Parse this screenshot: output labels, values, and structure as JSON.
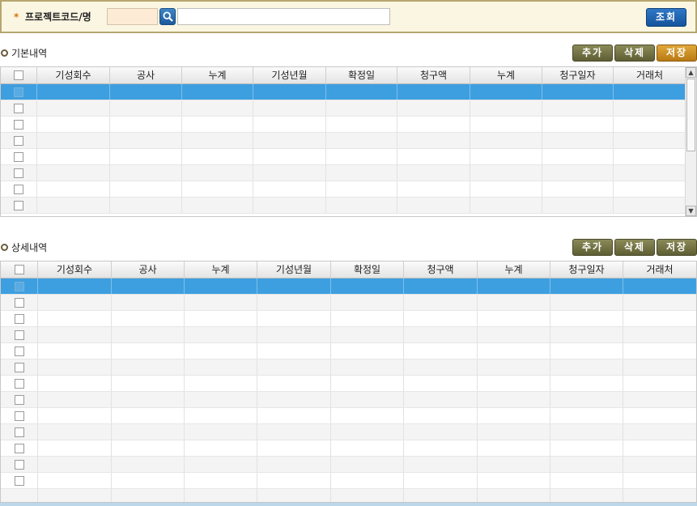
{
  "search": {
    "required_mark": "*",
    "label": "프로젝트코드/명",
    "code_value": "",
    "name_value": "",
    "query_label": "조회"
  },
  "basic": {
    "title": "기본내역",
    "buttons": {
      "add": "추가",
      "delete": "삭제",
      "save": "저장"
    },
    "columns": [
      "기성회수",
      "공사",
      "누계",
      "기성년월",
      "확정일",
      "청구액",
      "누계",
      "청구일자",
      "거래처"
    ]
  },
  "detail": {
    "title": "상세내역",
    "buttons": {
      "add": "추가",
      "delete": "삭제",
      "save": "저장"
    },
    "columns": [
      "기성회수",
      "공사",
      "누계",
      "기성년월",
      "확정일",
      "청구액",
      "누계",
      "청구일자",
      "거래처"
    ]
  },
  "colors": {
    "selected_row": "#3d9fe0",
    "save_button_basic": "#d39a2a",
    "olive_button": "#74744a",
    "query_button": "#1f64b0"
  }
}
